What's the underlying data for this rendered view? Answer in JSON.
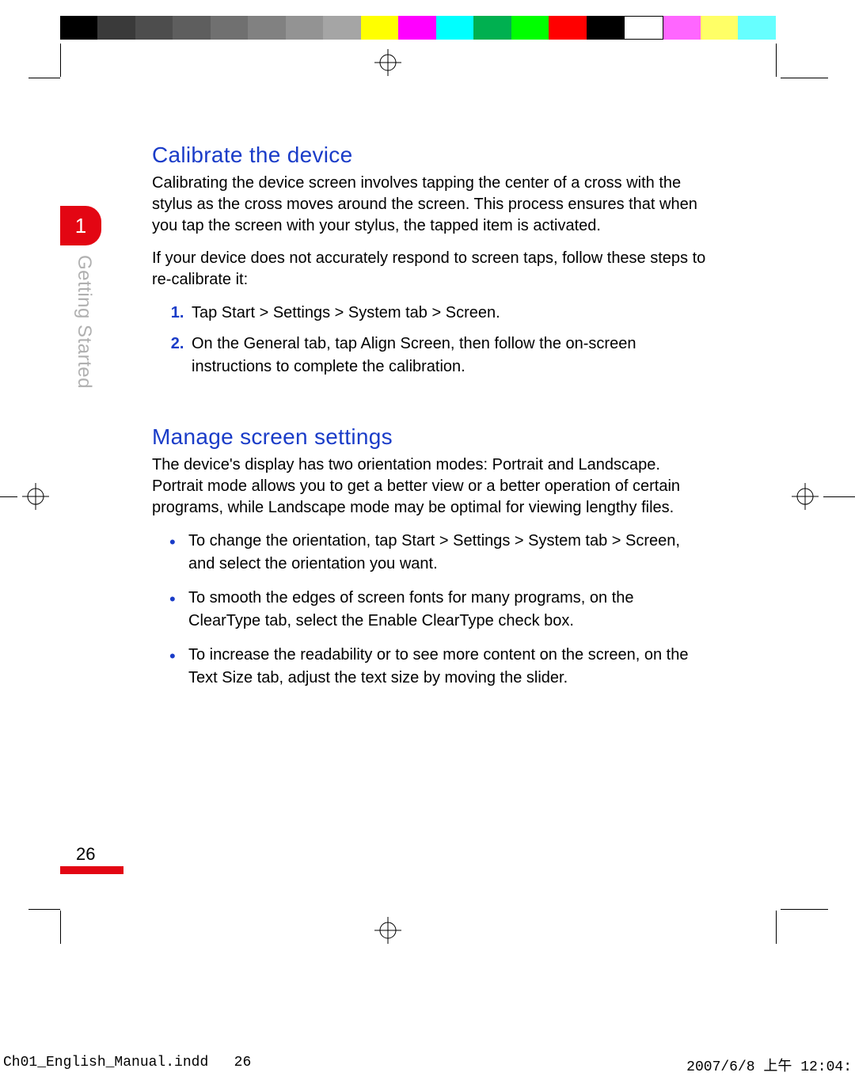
{
  "calibration_colors": [
    "#000000",
    "#3a3a3a",
    "#4d4d4d",
    "#5e5e5e",
    "#707070",
    "#818181",
    "#939393",
    "#a5a5a5",
    "#ffff00",
    "#ff00ff",
    "#00ffff",
    "#00b050",
    "#00ff00",
    "#ff0000",
    "#000000",
    "#ffffff",
    "#ff66ff",
    "#ffff66",
    "#66ffff"
  ],
  "chapter": {
    "number": "1",
    "section_label": "Getting Started"
  },
  "sections": [
    {
      "heading": "Calibrate the device",
      "paragraphs": [
        "Calibrating the device screen involves tapping the center of a cross with the stylus as the cross moves around the screen. This process ensures that when you tap the screen with your stylus, the tapped item is activated.",
        "If your device does not accurately respond to screen taps, follow these steps to re-calibrate it:"
      ],
      "ordered_list": [
        "Tap Start > Settings > System tab > Screen.",
        "On the General tab, tap Align Screen, then follow the on-screen instructions to complete the calibration."
      ]
    },
    {
      "heading": "Manage screen settings",
      "paragraphs": [
        "The device's display has two orientation modes: Portrait and Landscape. Portrait mode allows you to get a better view or a better operation of certain programs, while Landscape mode may be optimal for viewing lengthy files."
      ],
      "bullet_list": [
        "To change the orientation, tap Start > Settings > System tab > Screen, and select the orientation you want.",
        "To smooth the edges of screen fonts for many programs, on the ClearType tab, select the Enable ClearType check box.",
        "To increase the readability or to see more content on the screen, on the Text Size tab, adjust the text size by moving the slider."
      ]
    }
  ],
  "page_number": "26",
  "footer": {
    "file": "Ch01_English_Manual.indd",
    "page": "26",
    "datetime": "2007/6/8   上午 12:04:"
  }
}
